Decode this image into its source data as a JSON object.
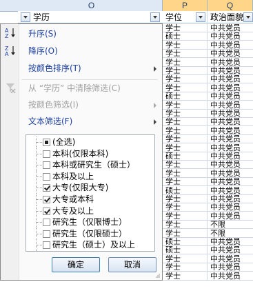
{
  "column_letters": {
    "o": "O",
    "p": "P",
    "q": "Q"
  },
  "filter_header": {
    "col_o": "学历",
    "col_p": "学位",
    "col_q": "政治面貌"
  },
  "rows": [
    {
      "p": "学士",
      "q": "中共党员"
    },
    {
      "p": "硕士",
      "q": "中共党员"
    },
    {
      "p": "学士",
      "q": "中共党员"
    },
    {
      "p": "学士",
      "q": "中共党员"
    },
    {
      "p": "学士",
      "q": "中共党员"
    },
    {
      "p": "学士",
      "q": "中共党员"
    },
    {
      "p": "学士",
      "q": "中共党员"
    },
    {
      "p": "学士",
      "q": "中共党员"
    },
    {
      "p": "硕士",
      "q": "中共党员"
    },
    {
      "p": "学士",
      "q": "中共党员"
    },
    {
      "p": "学士",
      "q": "中共党员"
    },
    {
      "p": "学士",
      "q": "中共党员"
    },
    {
      "p": "学士",
      "q": "中共党员"
    },
    {
      "p": "学士",
      "q": "中共党员"
    },
    {
      "p": "学士",
      "q": "中共党员"
    },
    {
      "p": "硕士",
      "q": "中共党员"
    },
    {
      "p": "学士",
      "q": "中共党员"
    },
    {
      "p": "学士",
      "q": "中共党员"
    },
    {
      "p": "学士",
      "q": "中共党员"
    },
    {
      "p": "硕士",
      "q": "中共党员"
    },
    {
      "p": "学士",
      "q": "中共党员"
    },
    {
      "p": "学士",
      "q": "中共党员"
    },
    {
      "p": "学士",
      "q": "中共党员"
    },
    {
      "p": "学士",
      "q": "不限"
    },
    {
      "p": "学士",
      "q": "不限"
    },
    {
      "p": "硕士",
      "q": "中共党员"
    },
    {
      "p": "硕士",
      "q": "中共党员"
    },
    {
      "p": "学士",
      "q": "中共党员"
    },
    {
      "p": "学士",
      "q": "中共党员"
    },
    {
      "p": "学士",
      "q": "中共党员"
    }
  ],
  "menu": {
    "sort_asc": "升序(S)",
    "sort_desc": "降序(O)",
    "sort_by_color": "按颜色排序(T)",
    "clear_filter": "从 “学历” 中清除筛选(C)",
    "filter_by_color": "按颜色筛选(I)",
    "text_filters": "文本筛选(F)"
  },
  "filter_list": [
    {
      "label": "(全选)",
      "state": "indeterminate"
    },
    {
      "label": "本科(仅限本科)",
      "state": "unchecked"
    },
    {
      "label": "本科或研究生（硕士）",
      "state": "unchecked"
    },
    {
      "label": "本科及以上",
      "state": "unchecked"
    },
    {
      "label": "大专(仅限大专)",
      "state": "checked"
    },
    {
      "label": "大专或本科",
      "state": "checked"
    },
    {
      "label": "大专及以上",
      "state": "checked"
    },
    {
      "label": "研究生（仅限博士）",
      "state": "unchecked"
    },
    {
      "label": "研究生（仅限硕士）",
      "state": "unchecked"
    },
    {
      "label": "研究生（硕士）及以上",
      "state": "unchecked"
    }
  ],
  "buttons": {
    "ok": "确定",
    "cancel": "取消"
  },
  "icons": {
    "sort_asc": "sort-ascending-icon",
    "sort_desc": "sort-descending-icon",
    "clear_filter": "clear-filter-icon",
    "dropdown": "chevron-down-icon"
  },
  "colors": {
    "accent_text": "#1b3fa0",
    "header_bg": "#dfe8f5",
    "selected_col_header": "#ffd58a"
  }
}
